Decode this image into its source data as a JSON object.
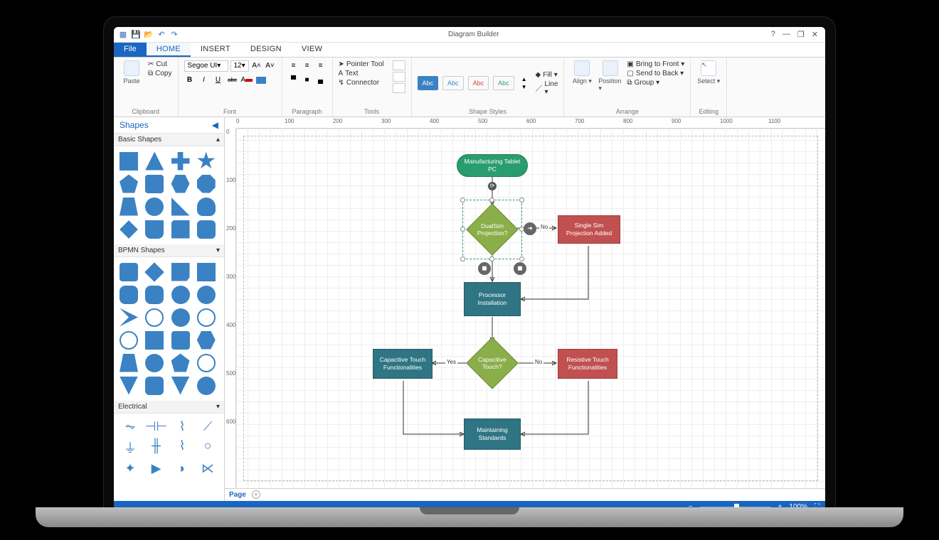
{
  "app": {
    "title": "Diagram Builder"
  },
  "qat": [
    "grid-icon",
    "save-icon",
    "open-icon",
    "undo-icon",
    "redo-icon"
  ],
  "window_controls": [
    "?",
    "—",
    "❐",
    "✕"
  ],
  "tabs": {
    "file": "File",
    "items": [
      "HOME",
      "INSERT",
      "DESIGN",
      "VIEW"
    ],
    "active": "HOME"
  },
  "ribbon": {
    "clipboard": {
      "label": "Clipboard",
      "paste": "Paste",
      "cut": "Cut",
      "copy": "Copy"
    },
    "font": {
      "label": "Font",
      "family": "Segoe UI",
      "size": "12",
      "buttons": [
        "B",
        "I",
        "U",
        "abc"
      ],
      "grow": "A˄",
      "shrink": "A˅"
    },
    "paragraph": {
      "label": "Paragraph"
    },
    "tools": {
      "label": "Tools",
      "pointer": "Pointer Tool",
      "text": "Text",
      "connector": "Connector"
    },
    "styles": {
      "label": "Shape Styles",
      "fill": "Fill ▾",
      "line": "Line ▾"
    },
    "arrange": {
      "label": "Arrange",
      "align": "Align ▾",
      "position": "Position ▾",
      "front": "Bring to Front ▾",
      "back": "Send to Back ▾",
      "group": "Group ▾"
    },
    "editing": {
      "label": "Editing",
      "select": "Select ▾"
    }
  },
  "shapes_panel": {
    "title": "Shapes",
    "categories": [
      "Basic Shapes",
      "BPMN Shapes",
      "Electrical"
    ]
  },
  "ruler": {
    "h": [
      "0",
      "100",
      "200",
      "300",
      "400",
      "500",
      "600",
      "700",
      "800",
      "900",
      "1000",
      "1100"
    ],
    "v": [
      "0",
      "100",
      "200",
      "300",
      "400",
      "500",
      "600"
    ]
  },
  "flow": {
    "nodes": {
      "start": {
        "label": "Manufacturing Tablet PC"
      },
      "dualsim": {
        "label": "DualSim Projection?"
      },
      "singlesim": {
        "label": "Single Sim Projection Added"
      },
      "processor": {
        "label": "Processor Installation"
      },
      "capq": {
        "label": "Capacitive Touch?"
      },
      "capfunc": {
        "label": "Capacitive Touch Functionalities"
      },
      "resfunc": {
        "label": "Resistive Touch Functionalities"
      },
      "maintain": {
        "label": "Maintaining Standards"
      }
    },
    "edges": {
      "ds_no": "No",
      "capq_yes": "Yes",
      "capq_no": "No"
    }
  },
  "page_tab": {
    "label": "Page"
  },
  "statusbar": {
    "zoom": "100%"
  }
}
